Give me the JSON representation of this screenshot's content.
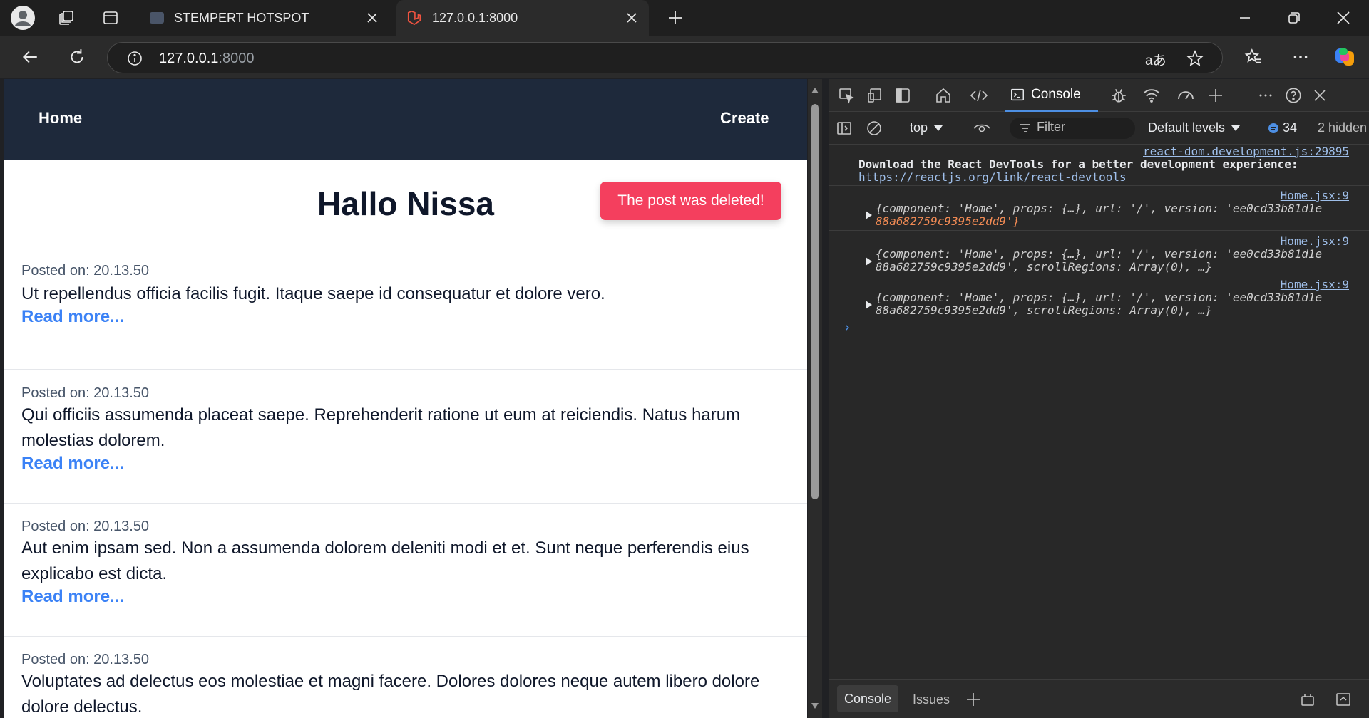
{
  "browser": {
    "tabs": [
      {
        "title": "STEMPERT HOTSPOT",
        "active": false
      },
      {
        "title": "127.0.0.1:8000",
        "active": true
      }
    ],
    "address": {
      "host": "127.0.0.1",
      "port": ":8000"
    },
    "translate_glyph": "aあ"
  },
  "page": {
    "nav": {
      "home_label": "Home",
      "create_label": "Create"
    },
    "greeting": "Hallo Nissa",
    "toast": "The post was deleted!",
    "posts": [
      {
        "meta": "Posted on: 20.13.50",
        "body": "Ut repellendus officia facilis fugit. Itaque saepe id consequatur et dolore vero.",
        "more": "Read more..."
      },
      {
        "meta": "Posted on: 20.13.50",
        "body": "Qui officiis assumenda placeat saepe. Reprehenderit ratione ut eum at reiciendis. Natus harum molestias dolorem.",
        "more": "Read more..."
      },
      {
        "meta": "Posted on: 20.13.50",
        "body": "Aut enim ipsam sed. Non a assumenda dolorem deleniti modi et et. Sunt neque perferendis eius explicabo est dicta.",
        "more": "Read more..."
      },
      {
        "meta": "Posted on: 20.13.50",
        "body": "Voluptates ad delectus eos molestiae et magni facere. Dolores dolores neque autem libero dolore dolore delectus.",
        "more": ""
      }
    ]
  },
  "devtools": {
    "console_tab_label": "Console",
    "context": "top",
    "filter_placeholder": "Filter",
    "levels": "Default levels",
    "message_count": "34",
    "hidden": "2 hidden",
    "messages": [
      {
        "source": "react-dom.development.js:29895",
        "line1": "Download the React DevTools for a better development experience:",
        "line2": "https://reactjs.org/link/react-devtools"
      },
      {
        "source": "Home.jsx:9",
        "line1": "{component: 'Home', props: {…}, url: '/', version: 'ee0cd33b81d1e",
        "line2": "88a682759c9395e2dd9'}"
      },
      {
        "source": "Home.jsx:9",
        "line1": "{component: 'Home', props: {…}, url: '/', version: 'ee0cd33b81d1e",
        "line2": "88a682759c9395e2dd9', scrollRegions: Array(0), …}"
      },
      {
        "source": "Home.jsx:9",
        "line1": "{component: 'Home', props: {…}, url: '/', version: 'ee0cd33b81d1e",
        "line2": "88a682759c9395e2dd9', scrollRegions: Array(0), …}"
      }
    ],
    "prompt": "›",
    "bottom_tabs": {
      "console": "Console",
      "issues": "Issues"
    }
  },
  "colors": {
    "navbar": "#1e293b",
    "toast": "#f43f5e",
    "link": "#3b82f6",
    "devtools_accent": "#4d8fe3"
  }
}
